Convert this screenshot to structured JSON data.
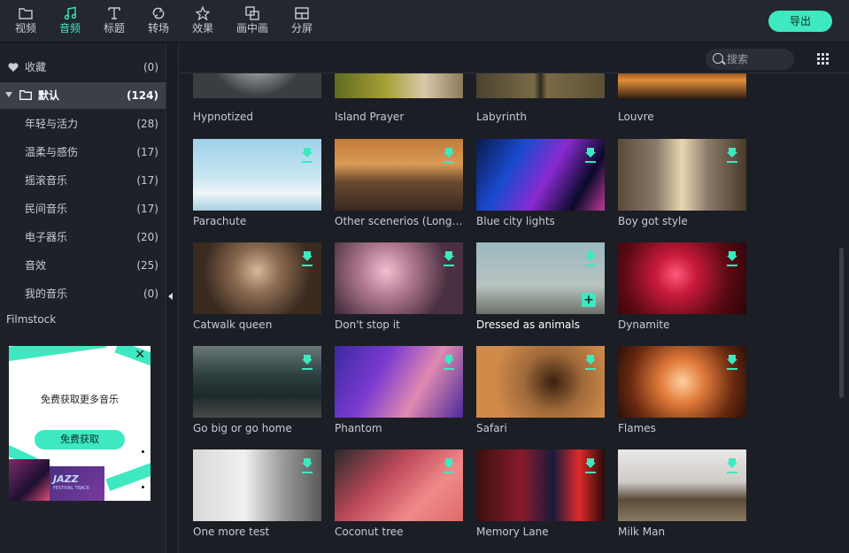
{
  "toolbar": {
    "tabs": [
      {
        "label": "视频",
        "icon": "folder-icon"
      },
      {
        "label": "音频",
        "icon": "music-note-icon"
      },
      {
        "label": "标题",
        "icon": "text-icon"
      },
      {
        "label": "转场",
        "icon": "transition-icon"
      },
      {
        "label": "效果",
        "icon": "effects-icon"
      },
      {
        "label": "画中画",
        "icon": "pip-icon"
      },
      {
        "label": "分屏",
        "icon": "split-screen-icon"
      }
    ],
    "active_tab": "音频",
    "export_label": "导出"
  },
  "sidebar": {
    "favorites": {
      "label": "收藏",
      "count": "(0)"
    },
    "default": {
      "label": "默认",
      "count": "(124)"
    },
    "items": [
      {
        "label": "年轻与活力",
        "count": "(28)"
      },
      {
        "label": "温柔与感伤",
        "count": "(17)"
      },
      {
        "label": "摇滚音乐",
        "count": "(17)"
      },
      {
        "label": "民间音乐",
        "count": "(17)"
      },
      {
        "label": "电子器乐",
        "count": "(20)"
      },
      {
        "label": "音效",
        "count": "(25)"
      },
      {
        "label": "我的音乐",
        "count": "(0)"
      }
    ],
    "filmstock_label": "Filmstock"
  },
  "ad": {
    "title": "免费获取更多音乐",
    "button_label": "免费获取",
    "close": "✕",
    "jazz_text": "JAZZ",
    "jazz_sub": "FESTIVAL TRACK"
  },
  "search": {
    "placeholder": "搜索"
  },
  "cards": [
    {
      "title": "Hypnotized",
      "download": false
    },
    {
      "title": "Island Prayer",
      "download": false
    },
    {
      "title": "Labyrinth",
      "download": false
    },
    {
      "title": "Louvre",
      "download": false
    },
    {
      "title": "Parachute",
      "download": true
    },
    {
      "title": "Other scenerios  (Long i...",
      "download": true
    },
    {
      "title": "Blue city lights",
      "download": true
    },
    {
      "title": "Boy got style",
      "download": true
    },
    {
      "title": "Catwalk queen",
      "download": true
    },
    {
      "title": "Don't stop it",
      "download": true
    },
    {
      "title": "Dressed as animals",
      "download": true,
      "hover": true,
      "add": "+"
    },
    {
      "title": "Dynamite",
      "download": true
    },
    {
      "title": "Go big or go home",
      "download": true
    },
    {
      "title": "Phantom",
      "download": true
    },
    {
      "title": "Safari",
      "download": true
    },
    {
      "title": "Flames",
      "download": true
    },
    {
      "title": "One more test",
      "download": true
    },
    {
      "title": "Coconut tree",
      "download": true
    },
    {
      "title": "Memory Lane",
      "download": true
    },
    {
      "title": "Milk Man",
      "download": true
    }
  ],
  "colors": {
    "accent": "#3ee8c0",
    "background": "#1b1e24",
    "toolbar": "#23272e"
  }
}
